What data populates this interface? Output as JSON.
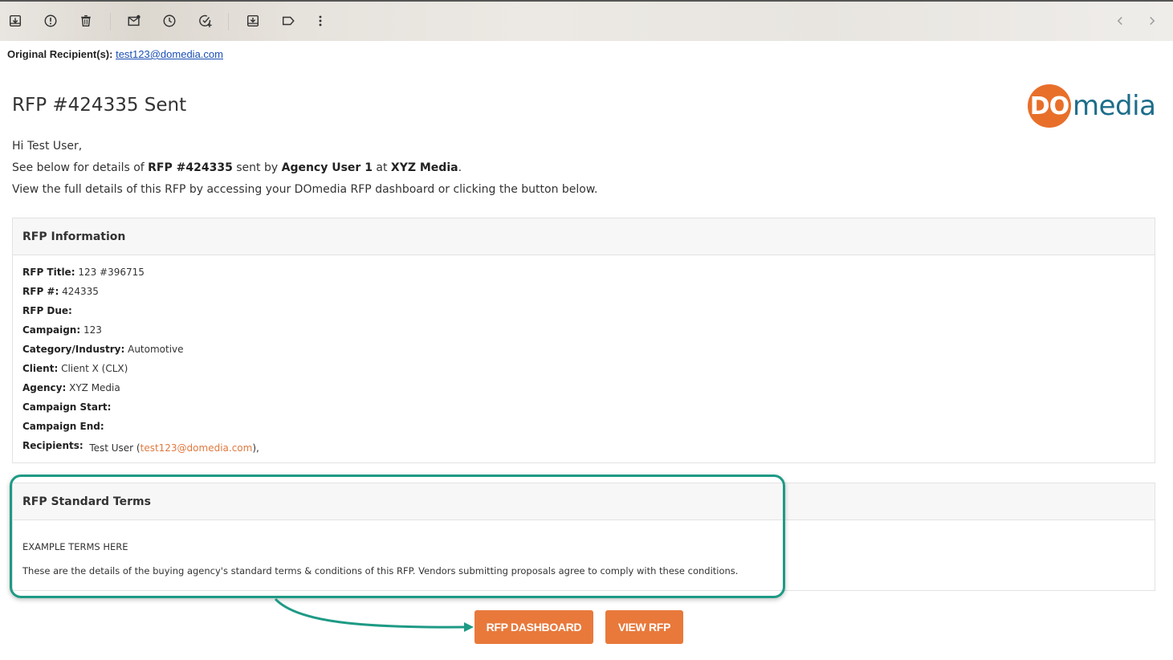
{
  "toolbar": {
    "icons": [
      "archive-icon",
      "report-spam-icon",
      "delete-icon",
      "mark-unread-icon",
      "snooze-icon",
      "add-task-icon",
      "move-to-icon",
      "label-icon",
      "more-icon"
    ],
    "nav": [
      "prev-icon",
      "next-icon"
    ]
  },
  "original": {
    "label": "Original Recipient(s):",
    "email": "test123@domedia.com"
  },
  "email": {
    "title": "RFP #424335 Sent",
    "logo": {
      "mark": "DO",
      "text": "media"
    },
    "greeting": "Hi Test User,",
    "line2": {
      "prefix": "See below for details of ",
      "rfp": "RFP #424335",
      "mid": " sent by ",
      "user": "Agency User 1",
      "at": " at ",
      "agency": "XYZ Media",
      "end": "."
    },
    "line3": "View the full details of this RFP by accessing your DOmedia RFP dashboard or clicking the button below."
  },
  "info": {
    "heading": "RFP Information",
    "rows": [
      {
        "label": "RFP Title:",
        "value": " 123 #396715"
      },
      {
        "label": "RFP #:",
        "value": " 424335"
      },
      {
        "label": "RFP Due:",
        "value": ""
      },
      {
        "label": "Campaign:",
        "value": " 123"
      },
      {
        "label": "Category/Industry:",
        "value": " Automotive"
      },
      {
        "label": "Client:",
        "value": " Client X (CLX)"
      },
      {
        "label": "Agency:",
        "value": " XYZ Media"
      },
      {
        "label": "Campaign Start:",
        "value": ""
      },
      {
        "label": "Campaign End:",
        "value": ""
      }
    ],
    "recipients": {
      "label": "Recipients:",
      "name": "Test User (",
      "email": "test123@domedia.com",
      "end": "),"
    }
  },
  "terms": {
    "heading": "RFP Standard Terms",
    "example": "EXAMPLE TERMS HERE",
    "detail": "These are the details of the buying agency's standard terms & conditions of this RFP. Vendors submitting proposals agree to comply with these conditions."
  },
  "buttons": {
    "dashboard": "RFP DASHBOARD",
    "view": "VIEW RFP"
  },
  "colors": {
    "accent": "#e8793b",
    "highlight": "#1e9a85",
    "logo_blue": "#1d6d8a"
  }
}
